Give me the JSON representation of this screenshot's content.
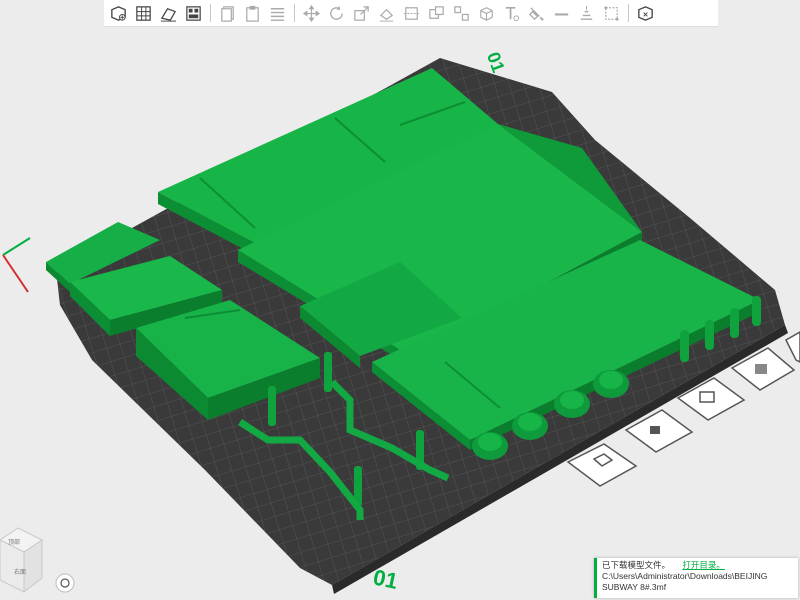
{
  "toolbar": {
    "icons": [
      "add-object-icon",
      "grid-plate-icon",
      "auto-orient-icon",
      "arrange-icon",
      "copy-icon",
      "paste-icon",
      "variable-layer-icon",
      "move-icon",
      "rotate-icon",
      "scale-icon",
      "place-on-face-icon",
      "cut-icon",
      "split-to-parts-icon",
      "split-to-objects-icon",
      "boolean-icon",
      "text-icon",
      "paint-icon",
      "seam-icon",
      "support-paint-icon",
      "measure-icon",
      "assembly-icon"
    ]
  },
  "plate": {
    "number_top": "01",
    "number_bottom": "01",
    "accent_color": "#00ae42",
    "model_color": "#0aa33a"
  },
  "view_cube": {
    "top_label": "顶部",
    "right_label": "右面"
  },
  "side_tools": [
    "slice-icon",
    "layout-icon",
    "lock-icon",
    "paint-bucket-icon",
    "face-icon"
  ],
  "notification": {
    "line1": "已下载模型文件。",
    "link": "打开目录。",
    "line2": "C:\\Users\\Administrator\\Downloads\\BEIJING",
    "line3": "SUBWAY 8#.3mf"
  }
}
